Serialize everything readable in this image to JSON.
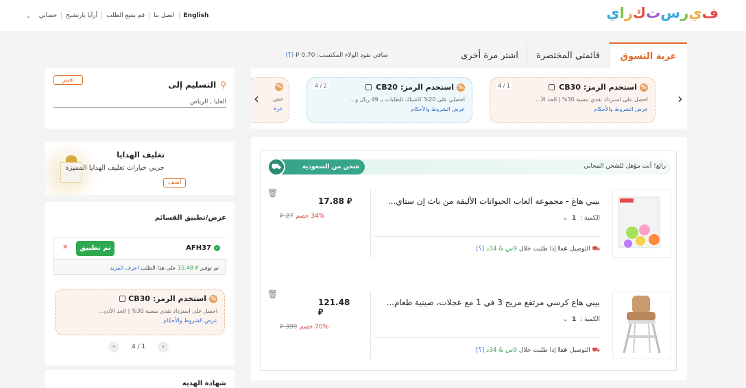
{
  "header": {
    "logo": [
      "ف",
      "ي",
      "ر",
      "س",
      "ت",
      "ك",
      "ر",
      "ا",
      "ي"
    ],
    "logo_colors": [
      "#e34b4b",
      "#f3a73a",
      "#7cc24b",
      "#3aa9d8",
      "#a35bd0",
      "#e34b4b",
      "#f3a73a",
      "#7cc24b",
      "#3aa9d8"
    ],
    "nav": {
      "language": "English",
      "contact": "اتصل بنا",
      "track_order": "قم بتتبع الطلب",
      "wishlist": "أرآيا بارتشيج",
      "account": "حسابي"
    }
  },
  "tabs": [
    {
      "label": "عربة التسوق",
      "active": true
    },
    {
      "label": "قائمتي المختصرة",
      "active": false
    },
    {
      "label": "اشتر مرة أخرى",
      "active": false
    }
  ],
  "loyalty": {
    "text": "صافي نقود الولاء المكتسب: 0.70",
    "currency": "⃁",
    "help": "(؟)"
  },
  "coupons": [
    {
      "label": "استخدم الرمز:",
      "code": "CB30",
      "count": "1 / 4",
      "desc": "احصل على استرداد نقدي بنسبة 30% | الحد الأ...",
      "terms": "عرض الشروط والأحكام"
    },
    {
      "label": "استخدم الرمز:",
      "code": "CB20",
      "count": "2 / 4",
      "desc": "احصلي على 20% كاشباك للطلبات بـ 49 ريال و...",
      "terms": "عرض الشروط والأحكام"
    },
    {
      "label": "",
      "code": "",
      "count": "",
      "desc": "خص",
      "terms": "عرة"
    }
  ],
  "cart": {
    "free_shipping_msg": "رائع! أنت مؤهل للشحن المجاني",
    "ship_from": "شحن من السعودية",
    "items": [
      {
        "title": "بيبي هاغ - مجموعة ألعاب الحيوانات الأليفة من باث إن ستاي...",
        "qty_label": "الكمية :",
        "qty": "1",
        "delivery_prefix": "التوصيل",
        "delivery_day": "غدا",
        "delivery_mid": "إذا طلبت خلال",
        "delivery_time": "9س & 34د",
        "help": "[؟]",
        "price": "17.88",
        "old_price": "27",
        "discount": "34% خصم"
      },
      {
        "title": "بيبي هاغ كرسي مرتفع مريح 3 في 1 مع عجلات، صينية طعام...",
        "qty_label": "الكمية :",
        "qty": "1",
        "delivery_prefix": "التوصيل",
        "delivery_day": "غدا",
        "delivery_mid": "إذا طلبت خلال",
        "delivery_time": "9س & 34د",
        "help": "[؟]",
        "price": "121.48",
        "old_price": "399",
        "discount": "70% خصم"
      }
    ]
  },
  "delivery": {
    "title": "التسليم إلى",
    "change": "تغيير",
    "address": "العليا , الرياض"
  },
  "gift": {
    "title": "تغليف الهدايا",
    "subtitle": "جربي خيارات تغليف الهدايا المميزة",
    "add": "أضف"
  },
  "voucher": {
    "title": "عرض/تطبيق القسائم",
    "code": "AFH37",
    "applied": "تم تطبيق",
    "save_prefix": "تم توفير",
    "save_amount": "15.48",
    "save_suffix": "على هذا الطلب",
    "learn_more": "اعرف المزيد",
    "coupon": {
      "label": "استخدم الرمز:",
      "code": "CB30",
      "desc": "احصل على استرداد نقدي بنسبة 30% | الحد الأدن...",
      "terms": "عرض الشروط والأحكام"
    },
    "pager": "4 / 1"
  },
  "giftcard": {
    "title": "شهادة الهدية"
  }
}
